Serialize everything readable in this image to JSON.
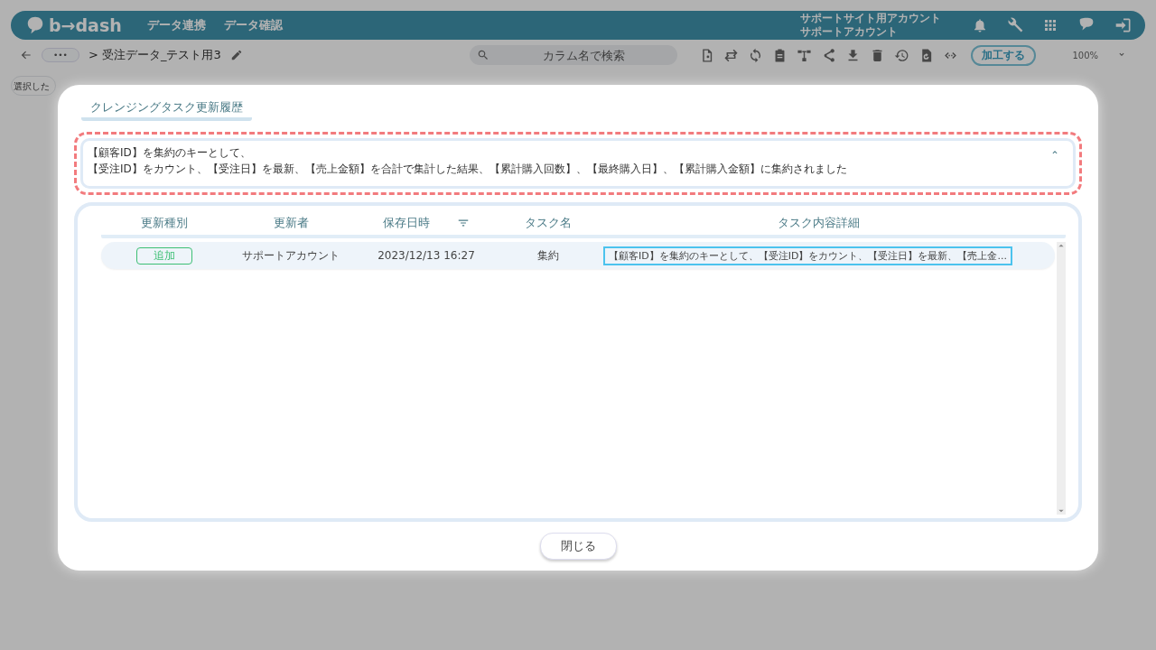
{
  "app": {
    "logo": "b→dash",
    "nav": [
      "データ連携",
      "データ確認"
    ],
    "account": {
      "site": "サポートサイト用アカウント",
      "user": "サポートアカウント"
    },
    "breadcrumb": {
      "more": "•••",
      "path": "> 受注データ_テスト用3"
    },
    "search": {
      "placeholder": "カラム名で検索"
    },
    "process_button": "加工する",
    "zoom": "100%",
    "selection_field": {
      "placeholder": "選択した"
    }
  },
  "dialog": {
    "title": "クレンジングタスク更新履歴",
    "summary": {
      "expanded": true,
      "lines": [
        "【顧客ID】を集約のキーとして、",
        "【受注ID】をカウント、【受注日】を最新、【売上金額】を合計で集計した結果、【累計購入回数】、【最終購入日】、【累計購入金額】に集約されました"
      ]
    },
    "table": {
      "columns": [
        {
          "label": "更新種別",
          "filter": false
        },
        {
          "label": "更新者",
          "filter": false
        },
        {
          "label": "保存日時",
          "filter": true
        },
        {
          "label": "タスク名",
          "filter": false
        },
        {
          "label": "タスク内容詳細",
          "filter": false
        }
      ],
      "rows": [
        {
          "selected": true,
          "type": "追加",
          "user": "サポートアカウント",
          "saved_at": "2023/12/13 16:27",
          "task": "集約",
          "detail": "【顧客ID】を集約のキーとして、【受注ID】をカウント、【受注日】を最新、【売上金...",
          "detail_focused": true
        }
      ]
    },
    "close_button": "閉じる"
  }
}
